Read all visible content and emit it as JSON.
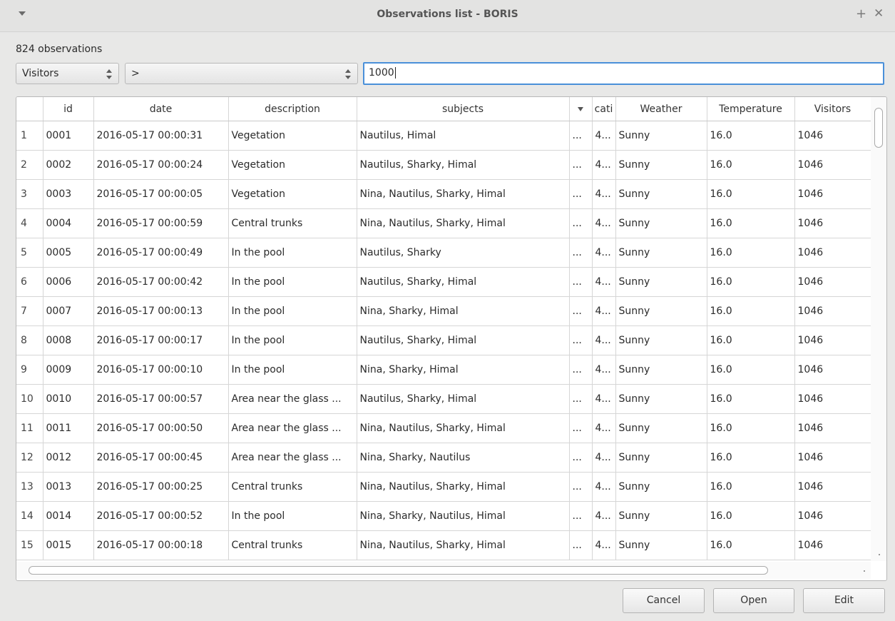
{
  "window": {
    "title": "Observations list - BORIS"
  },
  "count_label": "824 observations",
  "filter": {
    "field": "Visitors",
    "operator": ">",
    "value": "1000"
  },
  "table": {
    "columns": [
      "",
      "id",
      "date",
      "description",
      "subjects",
      "",
      "cati",
      "Weather",
      "Temperature",
      "Visitors"
    ],
    "rows": [
      [
        "1",
        "0001",
        "2016-05-17 00:00:31",
        "Vegetation",
        "Nautilus, Himal",
        "...",
        "4...",
        "Sunny",
        "16.0",
        "1046"
      ],
      [
        "2",
        "0002",
        "2016-05-17 00:00:24",
        "Vegetation",
        "Nautilus, Sharky, Himal",
        "...",
        "4...",
        "Sunny",
        "16.0",
        "1046"
      ],
      [
        "3",
        "0003",
        "2016-05-17 00:00:05",
        "Vegetation",
        "Nina, Nautilus, Sharky, Himal",
        "...",
        "4...",
        "Sunny",
        "16.0",
        "1046"
      ],
      [
        "4",
        "0004",
        "2016-05-17 00:00:59",
        "Central trunks",
        "Nina, Nautilus, Sharky, Himal",
        "...",
        "4...",
        "Sunny",
        "16.0",
        "1046"
      ],
      [
        "5",
        "0005",
        "2016-05-17 00:00:49",
        "In the pool",
        "Nautilus, Sharky",
        "...",
        "4...",
        "Sunny",
        "16.0",
        "1046"
      ],
      [
        "6",
        "0006",
        "2016-05-17 00:00:42",
        "In the pool",
        "Nautilus, Sharky, Himal",
        "...",
        "4...",
        "Sunny",
        "16.0",
        "1046"
      ],
      [
        "7",
        "0007",
        "2016-05-17 00:00:13",
        "In the pool",
        "Nina, Sharky, Himal",
        "...",
        "4...",
        "Sunny",
        "16.0",
        "1046"
      ],
      [
        "8",
        "0008",
        "2016-05-17 00:00:17",
        "In the pool",
        "Nautilus, Sharky, Himal",
        "...",
        "4...",
        "Sunny",
        "16.0",
        "1046"
      ],
      [
        "9",
        "0009",
        "2016-05-17 00:00:10",
        "In the pool",
        "Nina, Sharky, Himal",
        "...",
        "4...",
        "Sunny",
        "16.0",
        "1046"
      ],
      [
        "10",
        "0010",
        "2016-05-17 00:00:57",
        "Area near the glass ...",
        "Nautilus, Sharky, Himal",
        "...",
        "4...",
        "Sunny",
        "16.0",
        "1046"
      ],
      [
        "11",
        "0011",
        "2016-05-17 00:00:50",
        "Area near the glass ...",
        "Nina, Nautilus, Sharky, Himal",
        "...",
        "4...",
        "Sunny",
        "16.0",
        "1046"
      ],
      [
        "12",
        "0012",
        "2016-05-17 00:00:45",
        "Area near the glass ...",
        "Nina, Sharky, Nautilus",
        "...",
        "4...",
        "Sunny",
        "16.0",
        "1046"
      ],
      [
        "13",
        "0013",
        "2016-05-17 00:00:25",
        "Central trunks",
        "Nina, Nautilus, Sharky, Himal",
        "...",
        "4...",
        "Sunny",
        "16.0",
        "1046"
      ],
      [
        "14",
        "0014",
        "2016-05-17 00:00:52",
        "In the pool",
        "Nina, Sharky, Nautilus, Himal",
        "...",
        "4...",
        "Sunny",
        "16.0",
        "1046"
      ],
      [
        "15",
        "0015",
        "2016-05-17 00:00:18",
        "Central trunks",
        "Nina, Nautilus, Sharky, Himal",
        "...",
        "4...",
        "Sunny",
        "16.0",
        "1046"
      ]
    ]
  },
  "buttons": {
    "cancel": "Cancel",
    "open": "Open",
    "edit": "Edit"
  },
  "colors": {
    "accent": "#4a90d9",
    "background": "#e8e8e7"
  }
}
